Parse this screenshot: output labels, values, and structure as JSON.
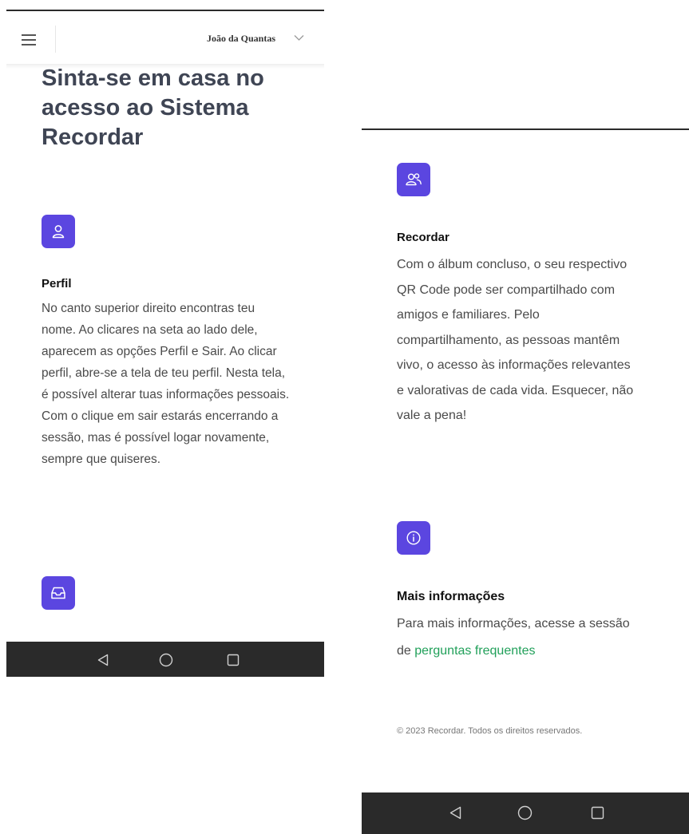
{
  "header": {
    "menu_icon": "hamburger-icon",
    "user_name": "João da Quantas",
    "user_menu_icon": "chevron-down-icon"
  },
  "hero": {
    "title": "Sinta-se em casa no acesso ao Sistema Recordar"
  },
  "sections": {
    "perfil": {
      "icon": "user-icon",
      "title": "Perfil",
      "text": "No canto superior direito encontras teu nome. Ao clicares na seta ao lado dele, aparecem as opções Perfil e Sair. Ao clicar perfil, abre-se a tela de teu perfil. Nesta tela, é possível alterar tuas informações pessoais. Com o clique em sair estarás encerrando a sessão, mas é possível logar novamente, sempre que quiseres."
    },
    "next": {
      "icon": "inbox-icon"
    },
    "recordar": {
      "icon": "users-icon",
      "title": "Recordar",
      "text": "Com o álbum concluso, o seu respectivo QR Code pode ser compartilhado com amigos e familiares. Pelo compartilhamento, as pessoas mantêm vivo, o acesso às informações relevantes e valorativas de cada vida. Esquecer, não vale a pena!"
    },
    "info": {
      "icon": "info-icon",
      "title": "Mais informações",
      "text_before": "Para mais informações, acesse a sessão de ",
      "link": "perguntas frequentes"
    }
  },
  "footer": {
    "copyright": "© 2023 Recordar. Todos os direitos reservados."
  },
  "system_nav": {
    "back_icon": "back-triangle-icon",
    "home_icon": "home-circle-icon",
    "recents_icon": "recents-square-icon"
  },
  "colors": {
    "accent": "#5b46e0",
    "link": "#21a05a",
    "navbar": "#2a2a2a"
  }
}
